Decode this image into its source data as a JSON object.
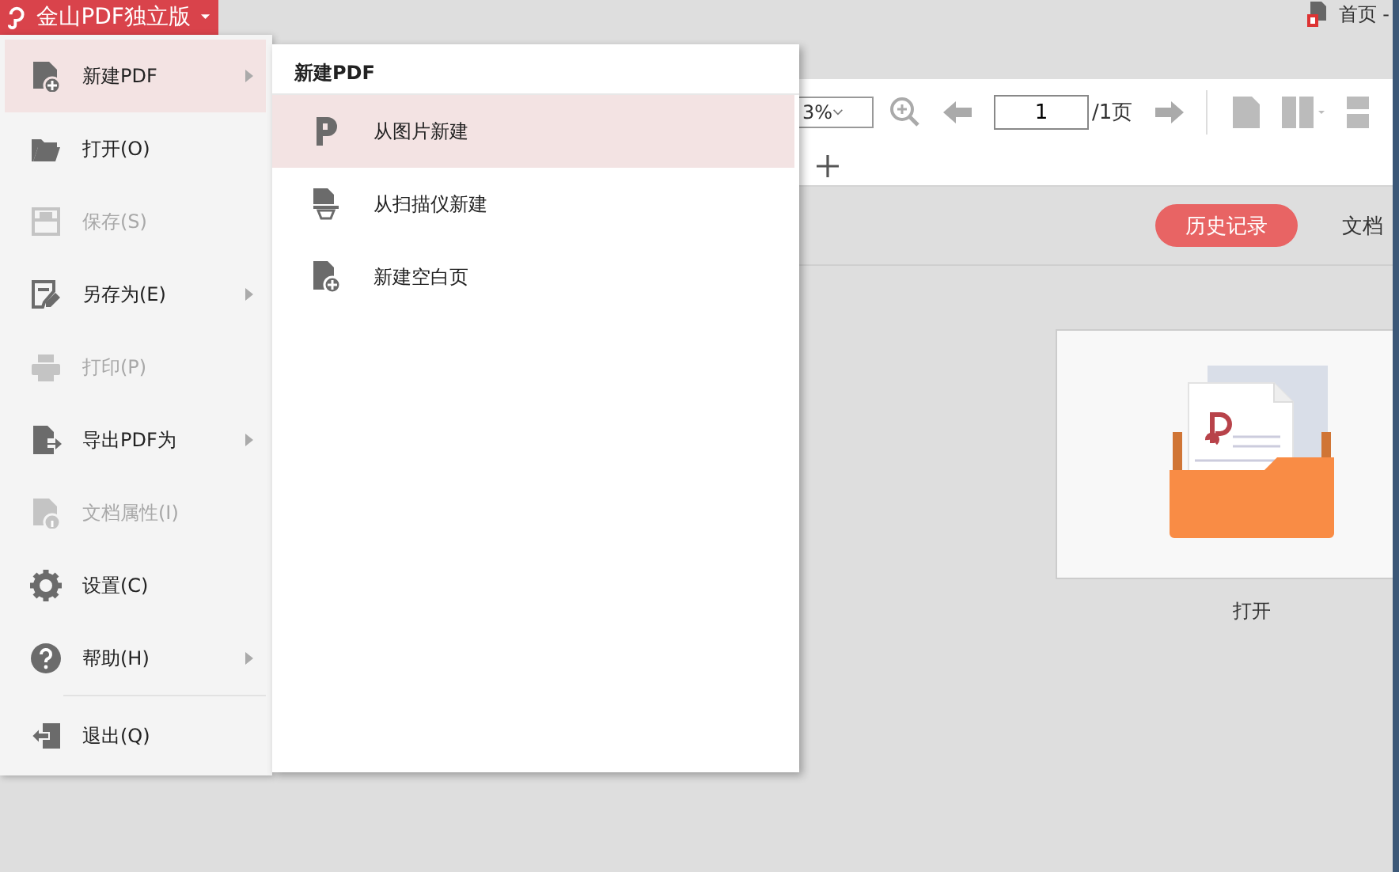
{
  "app_button": {
    "title": "金山PDF独立版"
  },
  "window": {
    "title": "首页 -"
  },
  "toolbar": {
    "zoom": "3%",
    "page": "1",
    "page_total": "/1页"
  },
  "history_button": "历史记录",
  "doc_tab": "文档",
  "open_card": {
    "label": "打开"
  },
  "menu": {
    "items": [
      {
        "label": "新建PDF",
        "selected": true,
        "disabled": false,
        "submenu": true,
        "separator_before": false
      },
      {
        "label": "打开(O)",
        "selected": false,
        "disabled": false,
        "submenu": false,
        "separator_before": false
      },
      {
        "label": "保存(S)",
        "selected": false,
        "disabled": true,
        "submenu": false,
        "separator_before": false
      },
      {
        "label": "另存为(E)",
        "selected": false,
        "disabled": false,
        "submenu": true,
        "separator_before": false
      },
      {
        "label": "打印(P)",
        "selected": false,
        "disabled": true,
        "submenu": false,
        "separator_before": false
      },
      {
        "label": "导出PDF为",
        "selected": false,
        "disabled": false,
        "submenu": true,
        "separator_before": false
      },
      {
        "label": "文档属性(I)",
        "selected": false,
        "disabled": true,
        "submenu": false,
        "separator_before": false
      },
      {
        "label": "设置(C)",
        "selected": false,
        "disabled": false,
        "submenu": false,
        "separator_before": false
      },
      {
        "label": "帮助(H)",
        "selected": false,
        "disabled": false,
        "submenu": true,
        "separator_before": false
      },
      {
        "label": "退出(Q)",
        "selected": false,
        "disabled": false,
        "submenu": false,
        "separator_before": true
      }
    ]
  },
  "submenu": {
    "title": "新建PDF",
    "items": [
      {
        "label": "从图片新建",
        "selected": true
      },
      {
        "label": "从扫描仪新建",
        "selected": false
      },
      {
        "label": "新建空白页",
        "selected": false
      }
    ]
  }
}
